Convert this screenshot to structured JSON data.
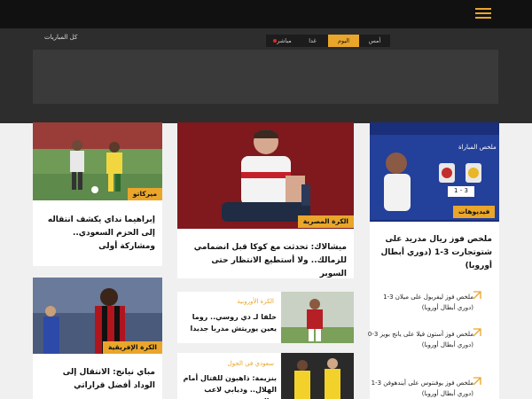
{
  "header": {
    "menu_icon": "hamburger-menu-icon",
    "accent": "#e9a62b"
  },
  "matches": {
    "all_label": "كل المباريات",
    "tabs": [
      {
        "label": "أمس"
      },
      {
        "label": "اليوم",
        "active": true
      },
      {
        "label": "غدا"
      },
      {
        "label": "مباشر"
      }
    ]
  },
  "cards": {
    "c1": {
      "badge": "ميركاتو",
      "title": "إبراهيما نداي يكشف انتقاله إلى الحزم السعودي.. ومشاركة أولى"
    },
    "c2": {
      "badge": "الكرة المصرية",
      "title": "ميشالاك: تحدثت مع كوكا قبل انضمامي للزمالك.. ولا أستطيع الانتظار حتى السوبر"
    },
    "c3": {
      "badge": "فيديوهات",
      "title": "ملخص فوز ريال مدريد على شتوتجارت 3-1 (دوري أبطال أوروبا)"
    },
    "c4": {
      "badge": "الكرة الإفريقية",
      "title": "مباي نيانج: الانتقال إلى الوداد أفضل قراراتي"
    },
    "r1": {
      "category": "الكرة الأوروبية",
      "title": "خلفا لـ دي روسي.. روما يعين يوريتش مدربا جديدا"
    },
    "r2": {
      "category": "سعودي في الجول",
      "title": "بنزيمة: ذاهبون للقتال أمام الهلال.. وديابي لاعب مثالي"
    }
  },
  "video_thumb": {
    "label": "ملخص المباراة",
    "score": "1 - 3"
  },
  "side_items": [
    "ملخص فوز ليفربول على ميلان 3-1 (دوري أبطال أوروبا)",
    "ملخص فوز أستون فيلا على يانج بويز 3-0 (دوري أبطال أوروبا)",
    "ملخص فوز يوفنتوس على أيندهوفن 3-1 (دوري أبطال أوروبا)"
  ]
}
